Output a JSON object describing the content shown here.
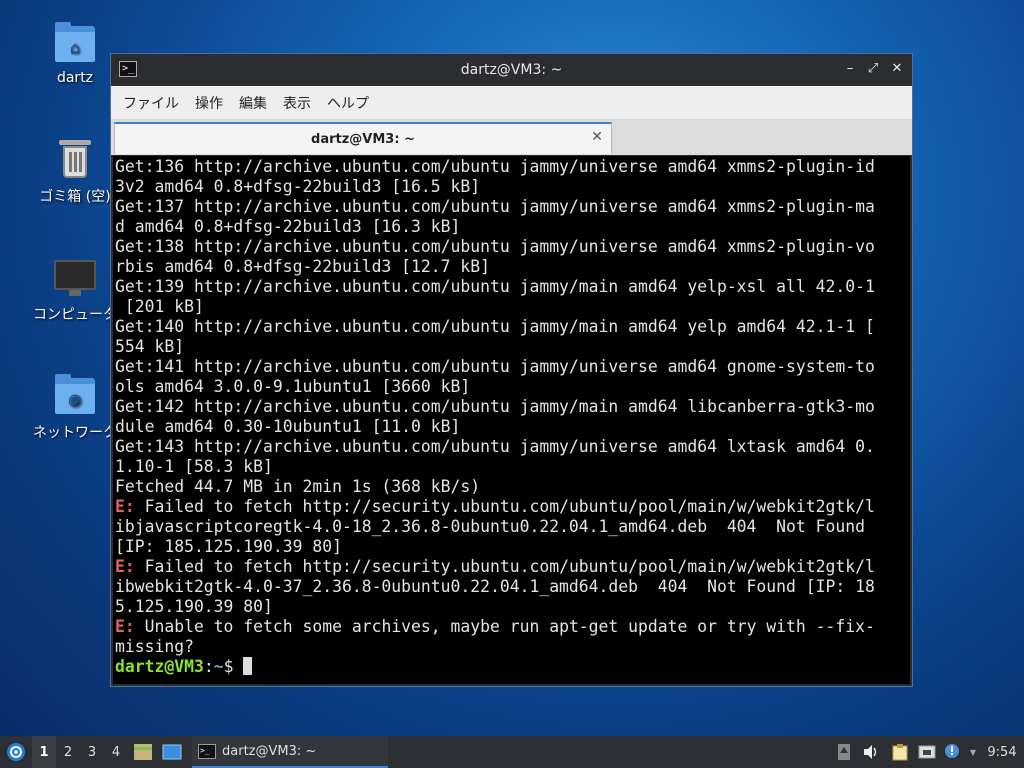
{
  "desktop": {
    "icons": [
      {
        "label": "dartz"
      },
      {
        "label": "ゴミ箱 (空)"
      },
      {
        "label": "コンピュータ"
      },
      {
        "label": "ネットワーク"
      }
    ]
  },
  "window": {
    "title": "dartz@VM3: ~",
    "controls": {
      "minimize": "–",
      "maximize": "⤢",
      "close": "✕"
    },
    "menu": [
      "ファイル",
      "操作",
      "編集",
      "表示",
      "ヘルプ"
    ],
    "tab": {
      "label": "dartz@VM3: ~",
      "close": "✕"
    }
  },
  "terminal": {
    "lines": [
      {
        "type": "text",
        "text": "Get:136 http://archive.ubuntu.com/ubuntu jammy/universe amd64 xmms2-plugin-id"
      },
      {
        "type": "text",
        "text": "3v2 amd64 0.8+dfsg-22build3 [16.5 kB]"
      },
      {
        "type": "text",
        "text": "Get:137 http://archive.ubuntu.com/ubuntu jammy/universe amd64 xmms2-plugin-ma"
      },
      {
        "type": "text",
        "text": "d amd64 0.8+dfsg-22build3 [16.3 kB]"
      },
      {
        "type": "text",
        "text": "Get:138 http://archive.ubuntu.com/ubuntu jammy/universe amd64 xmms2-plugin-vo"
      },
      {
        "type": "text",
        "text": "rbis amd64 0.8+dfsg-22build3 [12.7 kB]"
      },
      {
        "type": "text",
        "text": "Get:139 http://archive.ubuntu.com/ubuntu jammy/main amd64 yelp-xsl all 42.0-1"
      },
      {
        "type": "text",
        "text": " [201 kB]"
      },
      {
        "type": "text",
        "text": "Get:140 http://archive.ubuntu.com/ubuntu jammy/main amd64 yelp amd64 42.1-1 ["
      },
      {
        "type": "text",
        "text": "554 kB]"
      },
      {
        "type": "text",
        "text": "Get:141 http://archive.ubuntu.com/ubuntu jammy/universe amd64 gnome-system-to"
      },
      {
        "type": "text",
        "text": "ols amd64 3.0.0-9.1ubuntu1 [3660 kB]"
      },
      {
        "type": "text",
        "text": "Get:142 http://archive.ubuntu.com/ubuntu jammy/main amd64 libcanberra-gtk3-mo"
      },
      {
        "type": "text",
        "text": "dule amd64 0.30-10ubuntu1 [11.0 kB]"
      },
      {
        "type": "text",
        "text": "Get:143 http://archive.ubuntu.com/ubuntu jammy/universe amd64 lxtask amd64 0."
      },
      {
        "type": "text",
        "text": "1.10-1 [58.3 kB]"
      },
      {
        "type": "text",
        "text": "Fetched 44.7 MB in 2min 1s (368 kB/s)"
      },
      {
        "type": "error",
        "prefix": "E:",
        "text": " Failed to fetch http://security.ubuntu.com/ubuntu/pool/main/w/webkit2gtk/l"
      },
      {
        "type": "text",
        "text": "ibjavascriptcoregtk-4.0-18_2.36.8-0ubuntu0.22.04.1_amd64.deb  404  Not Found"
      },
      {
        "type": "text",
        "text": "[IP: 185.125.190.39 80]"
      },
      {
        "type": "error",
        "prefix": "E:",
        "text": " Failed to fetch http://security.ubuntu.com/ubuntu/pool/main/w/webkit2gtk/l"
      },
      {
        "type": "text",
        "text": "ibwebkit2gtk-4.0-37_2.36.8-0ubuntu0.22.04.1_amd64.deb  404  Not Found [IP: 18"
      },
      {
        "type": "text",
        "text": "5.125.190.39 80]"
      },
      {
        "type": "error",
        "prefix": "E:",
        "text": " Unable to fetch some archives, maybe run apt-get update or try with --fix-"
      },
      {
        "type": "text",
        "text": "missing?"
      }
    ],
    "prompt": {
      "user_host": "dartz@VM3",
      "sep": ":",
      "path": "~",
      "symbol": "$ "
    }
  },
  "taskbar": {
    "workspaces": [
      "1",
      "2",
      "3",
      "4"
    ],
    "active_workspace": "1",
    "task_label": "dartz@VM3: ~",
    "clock": "9:54"
  },
  "colors": {
    "error": "#e06464",
    "prompt_user": "#8ae234",
    "prompt_path": "#729fcf",
    "accent": "#3a7fd5"
  }
}
